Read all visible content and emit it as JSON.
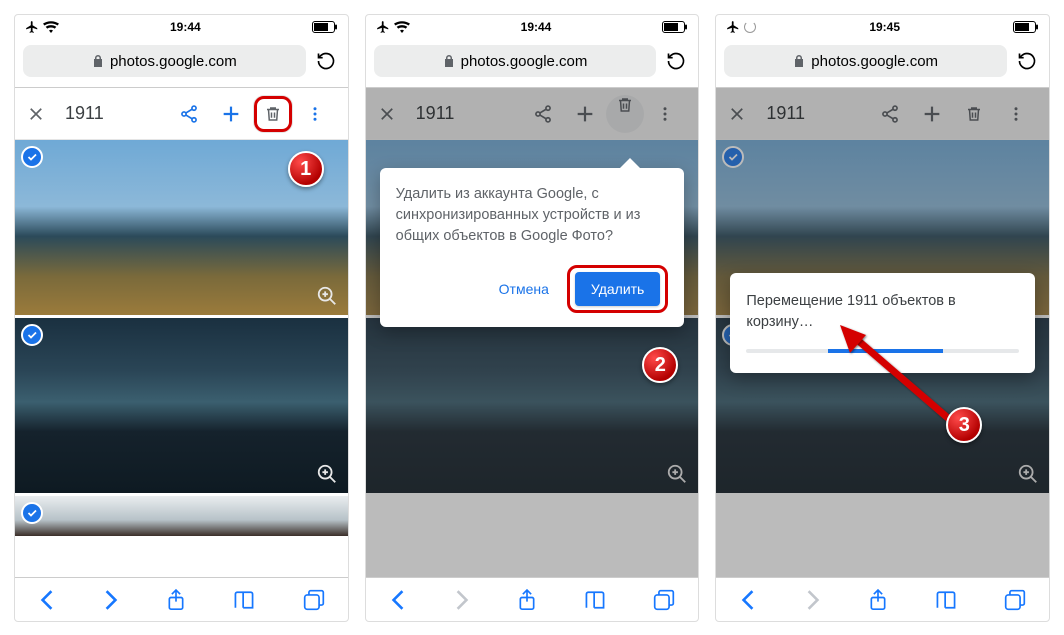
{
  "status": {
    "time_a": "19:44",
    "time_b": "19:44",
    "time_c": "19:45"
  },
  "url": "photos.google.com",
  "selection_count": "1911",
  "popover": {
    "text": "Удалить из аккаунта Google, с синхронизированных устройств и из общих объектов в Google Фото?",
    "cancel": "Отмена",
    "delete": "Удалить"
  },
  "toast": {
    "text": "Перемещение 1911 объектов в корзину…"
  },
  "badges": {
    "s1": "1",
    "s2": "2",
    "s3": "3"
  }
}
